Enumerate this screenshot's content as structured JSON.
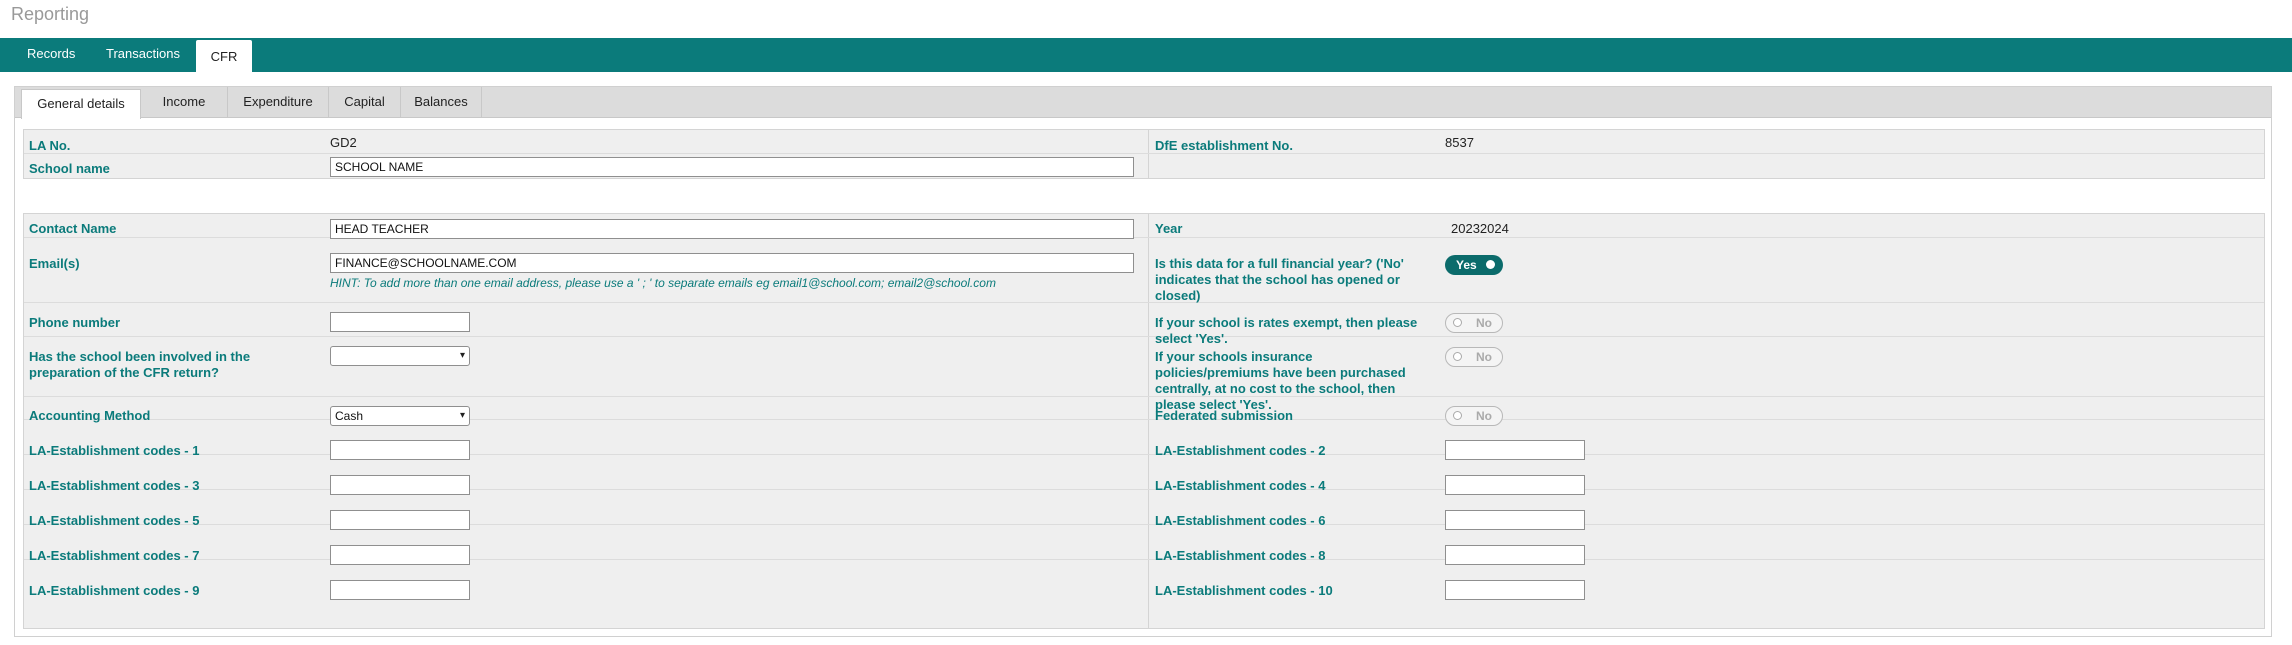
{
  "page": {
    "title": "Reporting"
  },
  "topnav": {
    "tabs": [
      "Records",
      "Transactions",
      "CFR"
    ],
    "active": "CFR"
  },
  "subtabs": {
    "tabs": [
      "General details",
      "Income",
      "Expenditure",
      "Capital",
      "Balances"
    ],
    "active": "General details"
  },
  "section1": {
    "la_no_label": "LA No.",
    "la_no_value": "GD2",
    "dfe_label": "DfE establishment No.",
    "dfe_value": "8537",
    "school_name_label": "School name",
    "school_name_value": "SCHOOL NAME"
  },
  "section2": {
    "contact_label": "Contact Name",
    "contact_value": "HEAD TEACHER",
    "year_label": "Year",
    "year_value": "20232024",
    "email_label": "Email(s)",
    "email_value": "FINANCE@SCHOOLNAME.COM",
    "email_hint": "HINT: To add more than one email address, please use a ' ; ' to separate emails eg email1@school.com; email2@school.com",
    "full_year_label": "Is this data for a full financial year? ('No' indicates that the school has opened or closed)",
    "full_year_toggle": "Yes",
    "phone_label": "Phone number",
    "phone_value": "",
    "rates_exempt_label": "If your school is rates exempt, then please select 'Yes'.",
    "rates_exempt_toggle": "No",
    "involved_label": "Has the school been involved in the preparation of the CFR return?",
    "involved_value": "",
    "insurance_label": "If your schools insurance policies/premiums have been purchased centrally, at no cost to the school, then please select 'Yes'.",
    "insurance_toggle": "No",
    "accounting_label": "Accounting Method",
    "accounting_value": "Cash",
    "federated_label": "Federated submission",
    "federated_toggle": "No",
    "la_codes": [
      "LA-Establishment codes - 1",
      "LA-Establishment codes - 2",
      "LA-Establishment codes - 3",
      "LA-Establishment codes - 4",
      "LA-Establishment codes - 5",
      "LA-Establishment codes - 6",
      "LA-Establishment codes - 7",
      "LA-Establishment codes - 8",
      "LA-Establishment codes - 9",
      "LA-Establishment codes - 10"
    ]
  },
  "colors": {
    "accent": "#0b7b7b",
    "toggle_on": "#0b6b6b"
  }
}
